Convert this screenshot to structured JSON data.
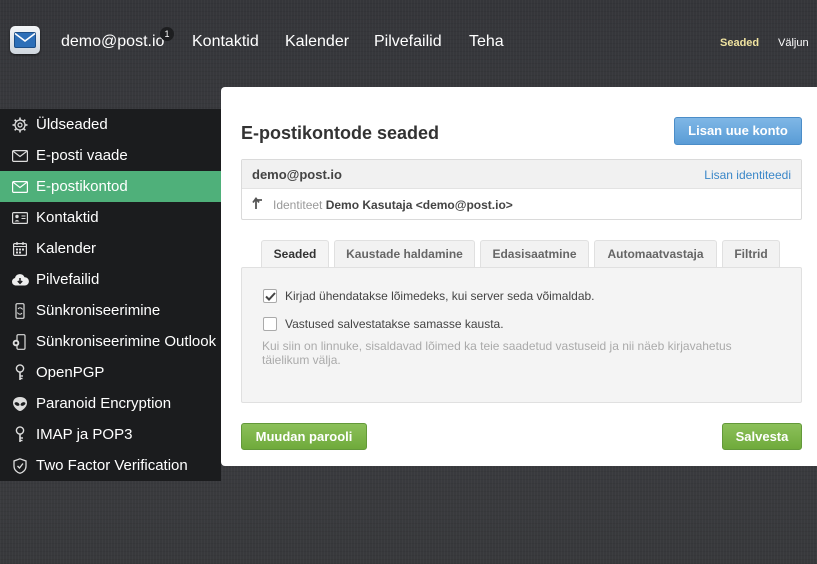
{
  "topbar": {
    "account": "demo@post.io",
    "badge": "1",
    "nav": [
      "Kontaktid",
      "Kalender",
      "Pilvefailid",
      "Teha"
    ],
    "settings": "Seaded",
    "logout": "Väljun"
  },
  "sidebar": {
    "items": [
      {
        "label": "Üldseaded",
        "icon": "gear-icon"
      },
      {
        "label": "E-posti vaade",
        "icon": "envelope-icon"
      },
      {
        "label": "E-postikontod",
        "icon": "envelope-icon",
        "active": true
      },
      {
        "label": "Kontaktid",
        "icon": "contact-card-icon"
      },
      {
        "label": "Kalender",
        "icon": "calendar-icon"
      },
      {
        "label": "Pilvefailid",
        "icon": "cloud-download-icon"
      },
      {
        "label": "Sünkroniseerimine",
        "icon": "sync-icon"
      },
      {
        "label": "Sünkroniseerimine Outlook",
        "icon": "sync-outlook-icon"
      },
      {
        "label": "OpenPGP",
        "icon": "key-icon"
      },
      {
        "label": "Paranoid Encryption",
        "icon": "alien-icon"
      },
      {
        "label": "IMAP ja POP3",
        "icon": "key-icon"
      },
      {
        "label": "Two Factor Verification",
        "icon": "shield-icon"
      }
    ]
  },
  "main": {
    "title": "E-postikontode seaded",
    "add_account_button": "Lisan uue konto",
    "account": {
      "email": "demo@post.io",
      "add_identity": "Lisan identiteedi",
      "identity_prefix": "Identiteet",
      "identity_value": "Demo Kasutaja <demo@post.io>"
    },
    "tabs": [
      "Seaded",
      "Kaustade haldamine",
      "Edasisaatmine",
      "Automaatvastaja",
      "Filtrid"
    ],
    "active_tab": "Seaded",
    "options": [
      {
        "label": "Kirjad ühendatakse lõimedeks, kui server seda võimaldab.",
        "checked": true
      },
      {
        "label": "Vastused salvestatakse samasse kausta.",
        "checked": false
      }
    ],
    "hint": "Kui siin on linnuke, sisaldavad lõimed ka teie saadetud vastuseid ja nii näeb kirjavahetus täielikum välja.",
    "change_password_button": "Muudan parooli",
    "save_button": "Salvesta"
  },
  "colors": {
    "active_sidebar": "#4fb07a",
    "primary_button": "#5a9cd6",
    "success_button": "#6faa3b",
    "link": "#3a87c8"
  }
}
